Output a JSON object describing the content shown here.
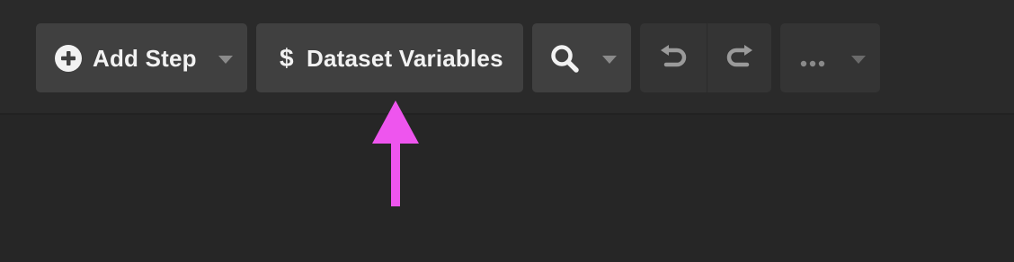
{
  "toolbar": {
    "add_step_label": "Add Step",
    "dataset_variables_label": "Dataset Variables",
    "dataset_variables_symbol": "$"
  },
  "icons": {
    "add": "plus-circle-icon",
    "dollar": "dollar-icon",
    "search": "search-icon",
    "undo": "undo-icon",
    "redo": "redo-icon",
    "more": "more-icon",
    "dropdown": "chevron-down-icon"
  },
  "colors": {
    "background": "#262626",
    "toolbar": "#2a2a2a",
    "button": "#404040",
    "button_dim": "#343434",
    "text": "#f2f2f2",
    "annotation_arrow": "#ee55ee"
  }
}
